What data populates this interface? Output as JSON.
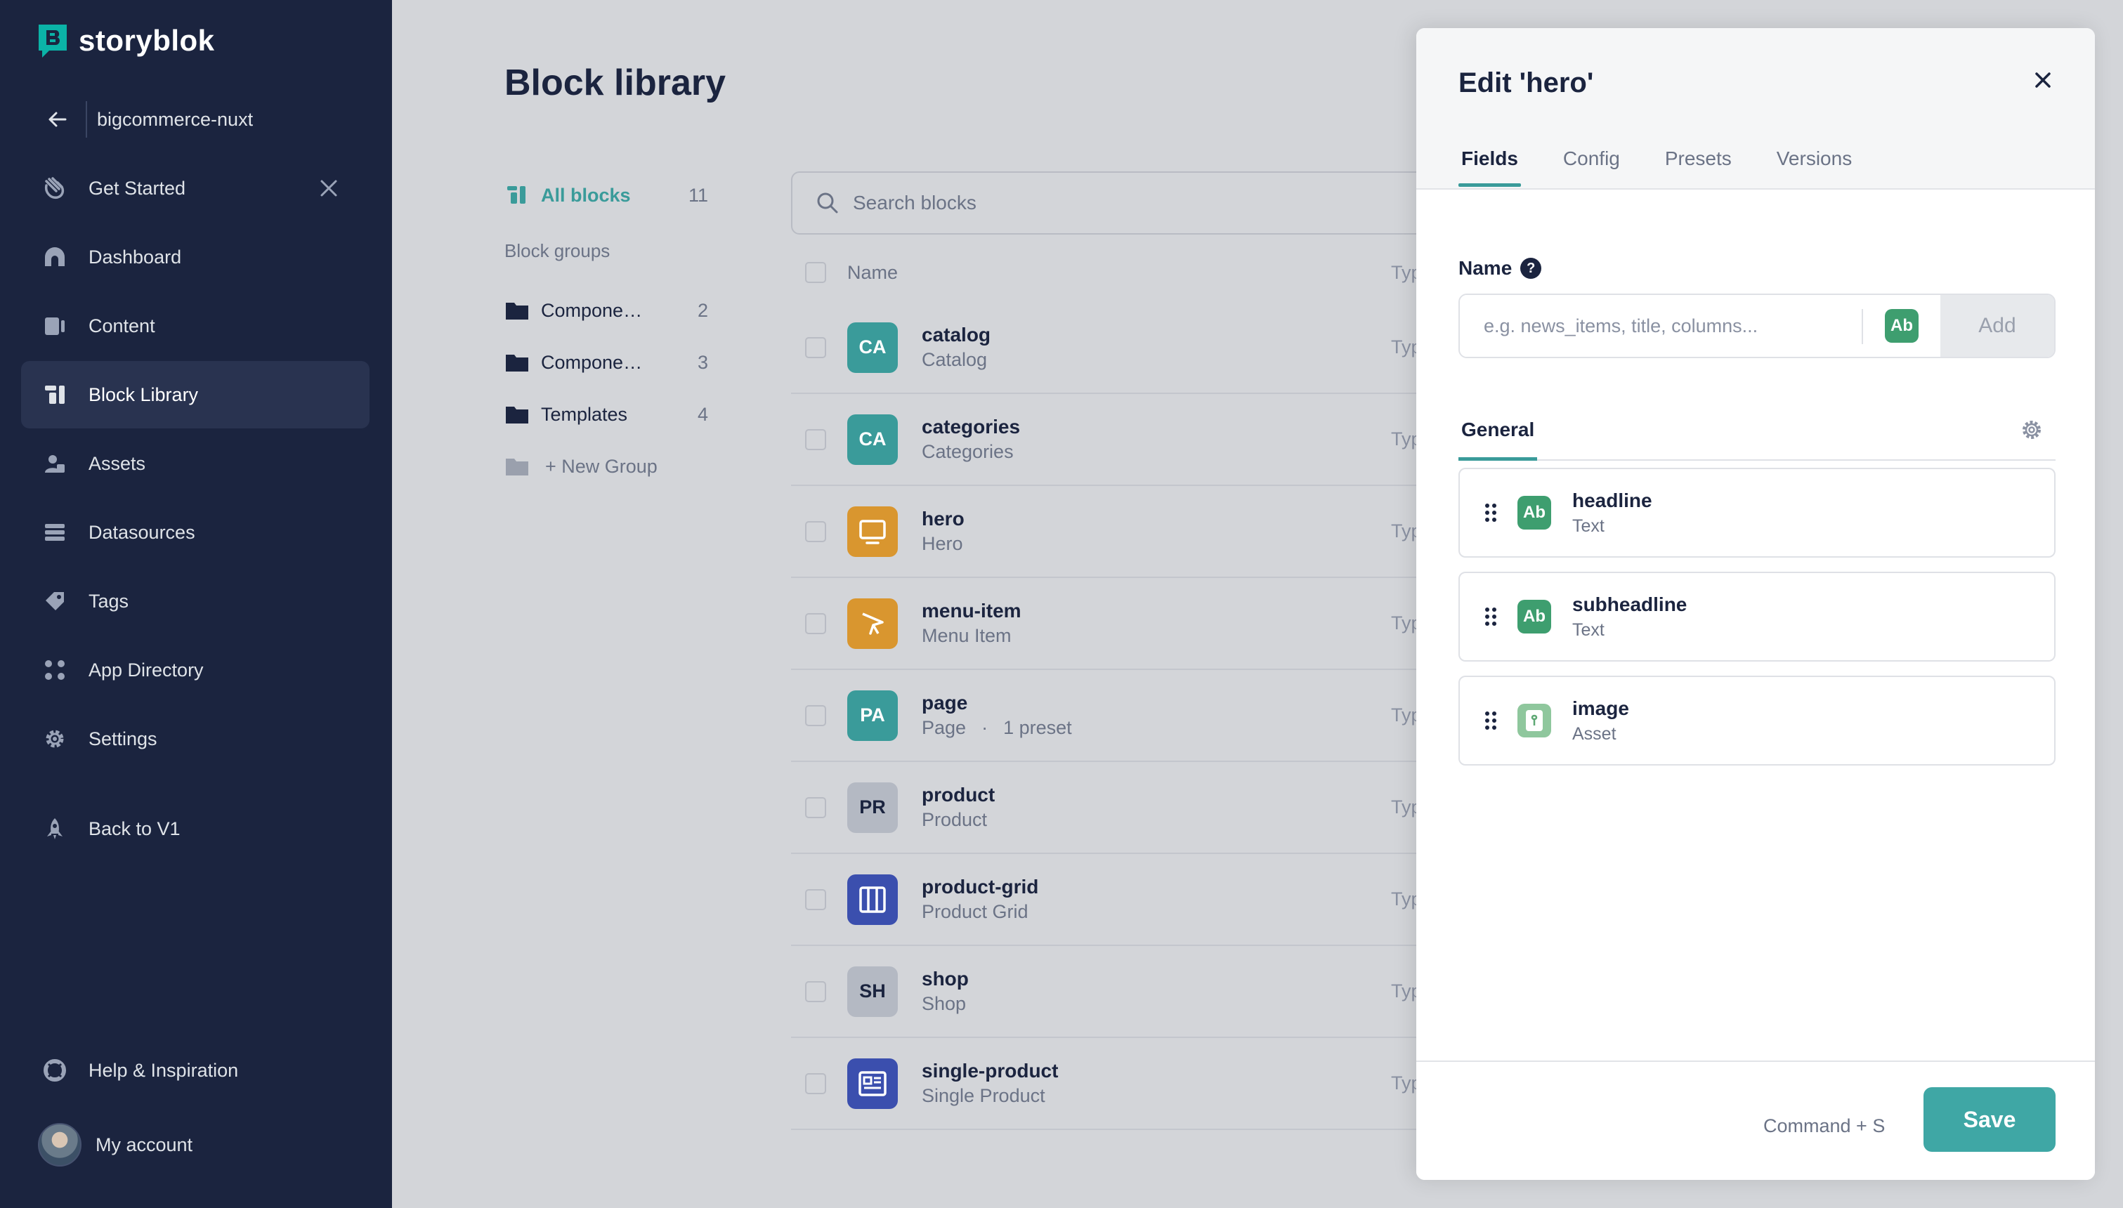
{
  "app": {
    "brand": "storyblok",
    "accent": "#3a9b9a"
  },
  "sidebar": {
    "space_name": "bigcommerce-nuxt",
    "items": [
      {
        "label": "Get Started",
        "icon": "hand-wave-icon"
      },
      {
        "label": "Dashboard",
        "icon": "dashboard-icon"
      },
      {
        "label": "Content",
        "icon": "content-icon"
      },
      {
        "label": "Block Library",
        "icon": "block-library-icon",
        "active": true
      },
      {
        "label": "Assets",
        "icon": "assets-icon"
      },
      {
        "label": "Datasources",
        "icon": "datasources-icon"
      },
      {
        "label": "Tags",
        "icon": "tag-icon"
      },
      {
        "label": "App Directory",
        "icon": "apps-icon"
      },
      {
        "label": "Settings",
        "icon": "gear-icon"
      },
      {
        "label": "Back to V1",
        "icon": "rocket-icon"
      }
    ],
    "help_label": "Help & Inspiration",
    "account_label": "My account"
  },
  "main": {
    "title": "Block library",
    "all_blocks": {
      "label": "All blocks",
      "count": "11"
    },
    "groups_label": "Block groups",
    "groups": [
      {
        "label": "Compone…",
        "count": "2"
      },
      {
        "label": "Compone…",
        "count": "3"
      },
      {
        "label": "Templates",
        "count": "4"
      }
    ],
    "new_group_label": "+ New Group",
    "search_placeholder": "Search blocks",
    "table": {
      "name_header": "Name",
      "type_header": "Typ",
      "rows": [
        {
          "badge": "CA",
          "name": "catalog",
          "display": "Catalog",
          "type": "Typ",
          "color": "#3a9b9a"
        },
        {
          "badge": "CA",
          "name": "categories",
          "display": "Categories",
          "type": "Typ",
          "color": "#3a9b9a"
        },
        {
          "badge": "",
          "icon": "monitor-icon",
          "name": "hero",
          "display": "Hero",
          "type": "Typ",
          "color": "#d9962f"
        },
        {
          "badge": "",
          "icon": "cursor-icon",
          "name": "menu-item",
          "display": "Menu Item",
          "type": "Typ",
          "color": "#d9962f"
        },
        {
          "badge": "PA",
          "name": "page",
          "display": "Page",
          "preset": "1 preset",
          "type": "Typ",
          "color": "#3a9b9a"
        },
        {
          "badge": "PR",
          "name": "product",
          "display": "Product",
          "type": "Typ",
          "color": "#b4b9c3"
        },
        {
          "badge": "",
          "icon": "columns-icon",
          "name": "product-grid",
          "display": "Product Grid",
          "type": "Typ",
          "color": "#3b4fae"
        },
        {
          "badge": "SH",
          "name": "shop",
          "display": "Shop",
          "type": "Typ",
          "color": "#b4b9c3"
        },
        {
          "badge": "",
          "icon": "article-icon",
          "name": "single-product",
          "display": "Single Product",
          "type": "Typ",
          "color": "#3b4fae"
        }
      ]
    }
  },
  "modal": {
    "title": "Edit 'hero'",
    "tabs": [
      "Fields",
      "Config",
      "Presets",
      "Versions"
    ],
    "name_label": "Name",
    "help_glyph": "?",
    "name_placeholder": "e.g. news_items, title, columns...",
    "type_badge": "Ab",
    "add_label": "Add",
    "group_tab": "General",
    "fields": [
      {
        "name": "headline",
        "type": "Text",
        "badge": "Ab"
      },
      {
        "name": "subheadline",
        "type": "Text",
        "badge": "Ab"
      },
      {
        "name": "image",
        "type": "Asset",
        "badge": ""
      }
    ],
    "shortcut": "Command + S",
    "save_label": "Save"
  }
}
